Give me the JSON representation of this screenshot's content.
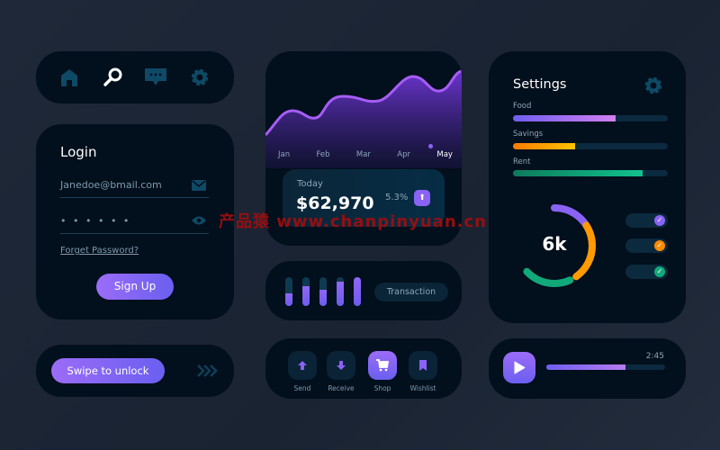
{
  "nav": {
    "icons": [
      "home-icon",
      "search-icon",
      "chat-icon",
      "gear-icon"
    ],
    "active": "search-icon"
  },
  "login": {
    "title": "Login",
    "email": "Janedoe@bmail.com",
    "password_mask": "• • • • • •",
    "forgot": "Forget Password?",
    "signup": "Sign Up"
  },
  "swipe": {
    "label": "Swipe to unlock"
  },
  "chart_card": {
    "months": [
      "Jan",
      "Feb",
      "Mar",
      "Apr",
      "May"
    ],
    "active_month": "May",
    "today_label": "Today",
    "amount": "$62,970",
    "change": "5.3%"
  },
  "transaction": {
    "label": "Transaction",
    "levels": [
      0.45,
      0.7,
      0.55,
      0.85,
      1.0
    ]
  },
  "actions": [
    {
      "label": "Send",
      "icon": "arrow-up-icon"
    },
    {
      "label": "Receive",
      "icon": "arrow-down-icon"
    },
    {
      "label": "Shop",
      "icon": "cart-icon",
      "active": true
    },
    {
      "label": "Wishlist",
      "icon": "bookmark-icon"
    }
  ],
  "settings": {
    "title": "Settings",
    "bars": [
      {
        "label": "Food",
        "value": 0.66,
        "color": "#b57bf0"
      },
      {
        "label": "Savings",
        "value": 0.4,
        "color": "#ffb300"
      },
      {
        "label": "Rent",
        "value": 0.84,
        "color": "#12b981"
      }
    ],
    "donut_value": "6k",
    "toggles": [
      {
        "on": true,
        "color": "#8a63f5"
      },
      {
        "on": true,
        "color": "#ff8a00"
      },
      {
        "on": true,
        "color": "#12a97a"
      }
    ]
  },
  "player": {
    "time": "2:45",
    "progress": 0.67
  },
  "watermark": "产品猿 www.chanpinyuan.cn"
}
